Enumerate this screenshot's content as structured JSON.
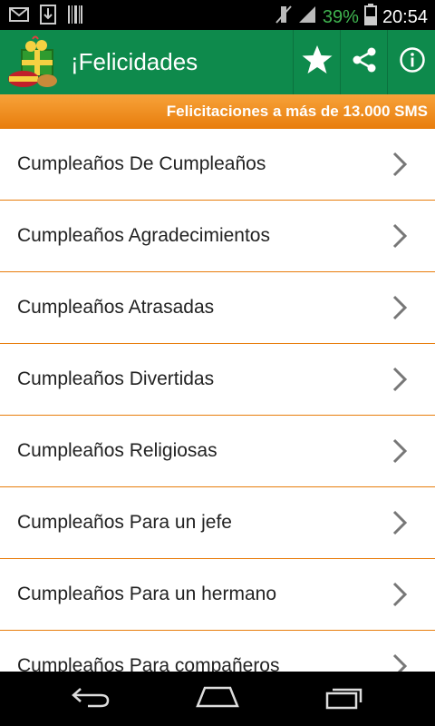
{
  "status_bar": {
    "icons": [
      "mail-icon",
      "download-icon",
      "barcode-icon",
      "muted-icon",
      "signal-icon",
      "battery-icon"
    ],
    "battery": "39%",
    "time": "20:54",
    "battery_color": "#3fb34f"
  },
  "action_bar": {
    "title": "¡Felicidades",
    "color": "#0e8a4c",
    "actions": [
      "star-icon",
      "share-icon",
      "info-icon"
    ]
  },
  "banner": {
    "text": "Felicitaciones a más de 13.000 SMS",
    "color": "#f18e1d"
  },
  "list": {
    "divider_color": "#e87d0c",
    "items": [
      {
        "label": "Cumpleaños De Cumpleaños"
      },
      {
        "label": "Cumpleaños Agradecimientos"
      },
      {
        "label": "Cumpleaños Atrasadas"
      },
      {
        "label": "Cumpleaños Divertidas"
      },
      {
        "label": "Cumpleaños Religiosas"
      },
      {
        "label": "Cumpleaños Para un jefe"
      },
      {
        "label": "Cumpleaños Para un hermano"
      },
      {
        "label": "Cumpleaños Para compañeros"
      }
    ]
  },
  "nav_bar": {
    "buttons": [
      "back-icon",
      "home-icon",
      "recent-apps-icon"
    ]
  }
}
